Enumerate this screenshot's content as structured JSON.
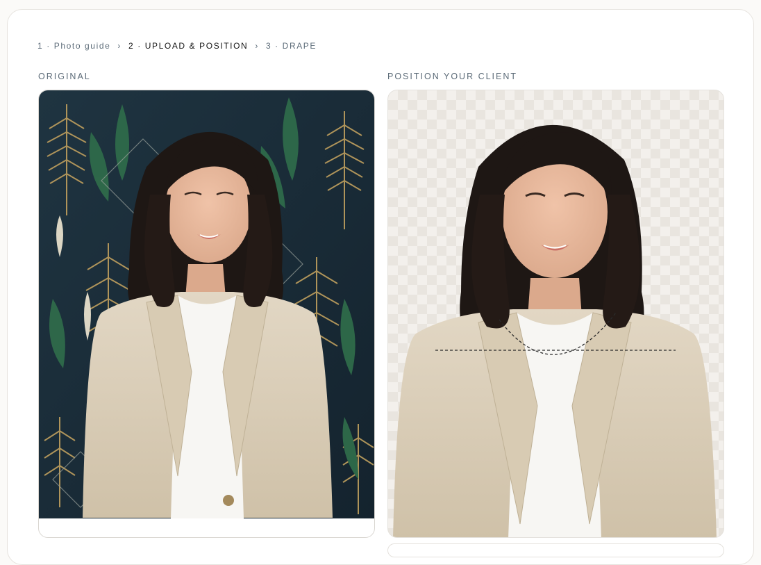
{
  "steps": [
    {
      "label": "1 · Photo guide",
      "state": "done"
    },
    {
      "label": "2 · UPLOAD & POSITION",
      "state": "active"
    },
    {
      "label": "3 · DRAPE",
      "state": "upcoming"
    }
  ],
  "step_separator": "›",
  "original": {
    "label": "ORIGINAL",
    "image": "Portrait of woman in linen blazer and white tee against green and gold fern wallpaper"
  },
  "position": {
    "label": "POSITION YOUR CLIENT",
    "image": "Background-removed portrait on transparent checkerboard with dashed neckline and shoulder guides"
  },
  "colors": {
    "wallpaper": "#1b2e3b",
    "fern_green": "#2f6b4a",
    "fern_gold": "#b89a5c",
    "blazer": "#d9cdb8",
    "tee": "#f7f6f3",
    "hair": "#1e1714",
    "skin": "#e8b79b"
  }
}
